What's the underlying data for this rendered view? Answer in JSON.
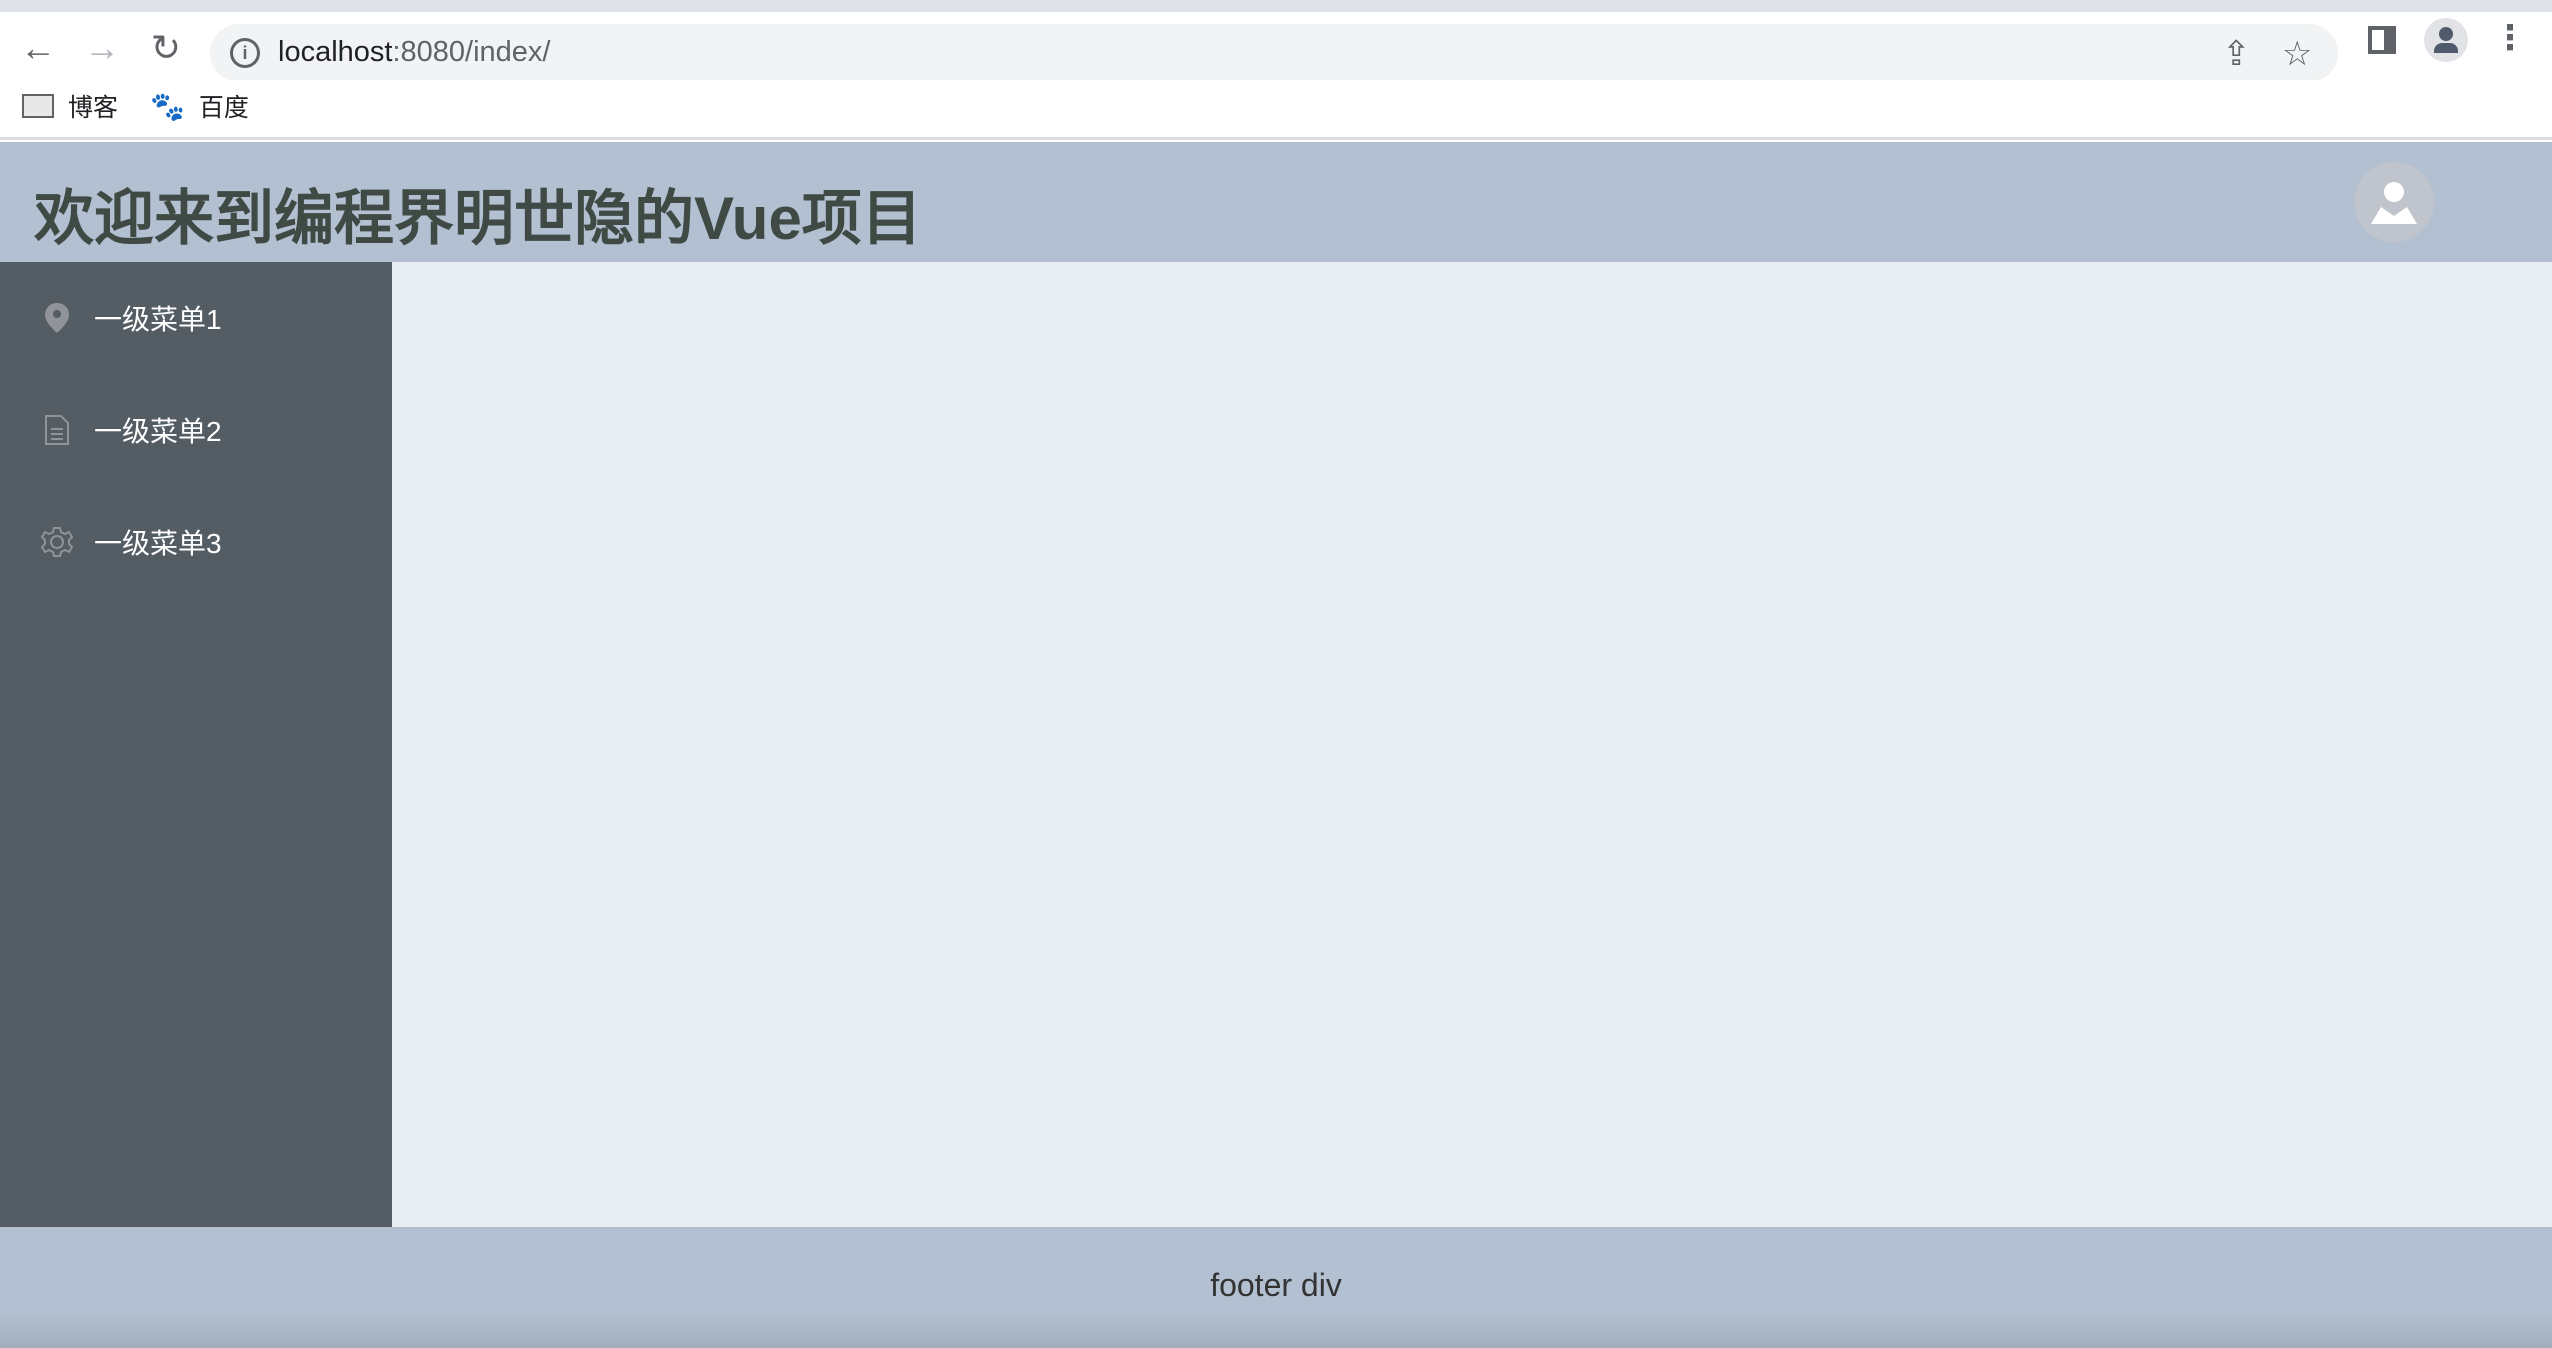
{
  "browser": {
    "url_host": "localhost",
    "url_rest": ":8080/index/",
    "bookmarks": [
      {
        "label": "博客",
        "icon": "folder-icon"
      },
      {
        "label": "百度",
        "icon": "baidu-paw-icon"
      }
    ]
  },
  "header": {
    "title": "欢迎来到编程界明世隐的Vue项目",
    "avatar_icon": "user-avatar-icon"
  },
  "sidebar": {
    "items": [
      {
        "label": "一级菜单1",
        "icon": "location-icon"
      },
      {
        "label": "一级菜单2",
        "icon": "document-icon"
      },
      {
        "label": "一级菜单3",
        "icon": "setting-icon"
      }
    ]
  },
  "footer": {
    "text": "footer div"
  },
  "colors": {
    "header": "#b3c0d1",
    "sidebar": "#545c64",
    "main": "#e9eef3",
    "footer": "#b3c0d1",
    "menu_text": "#ffffff"
  }
}
